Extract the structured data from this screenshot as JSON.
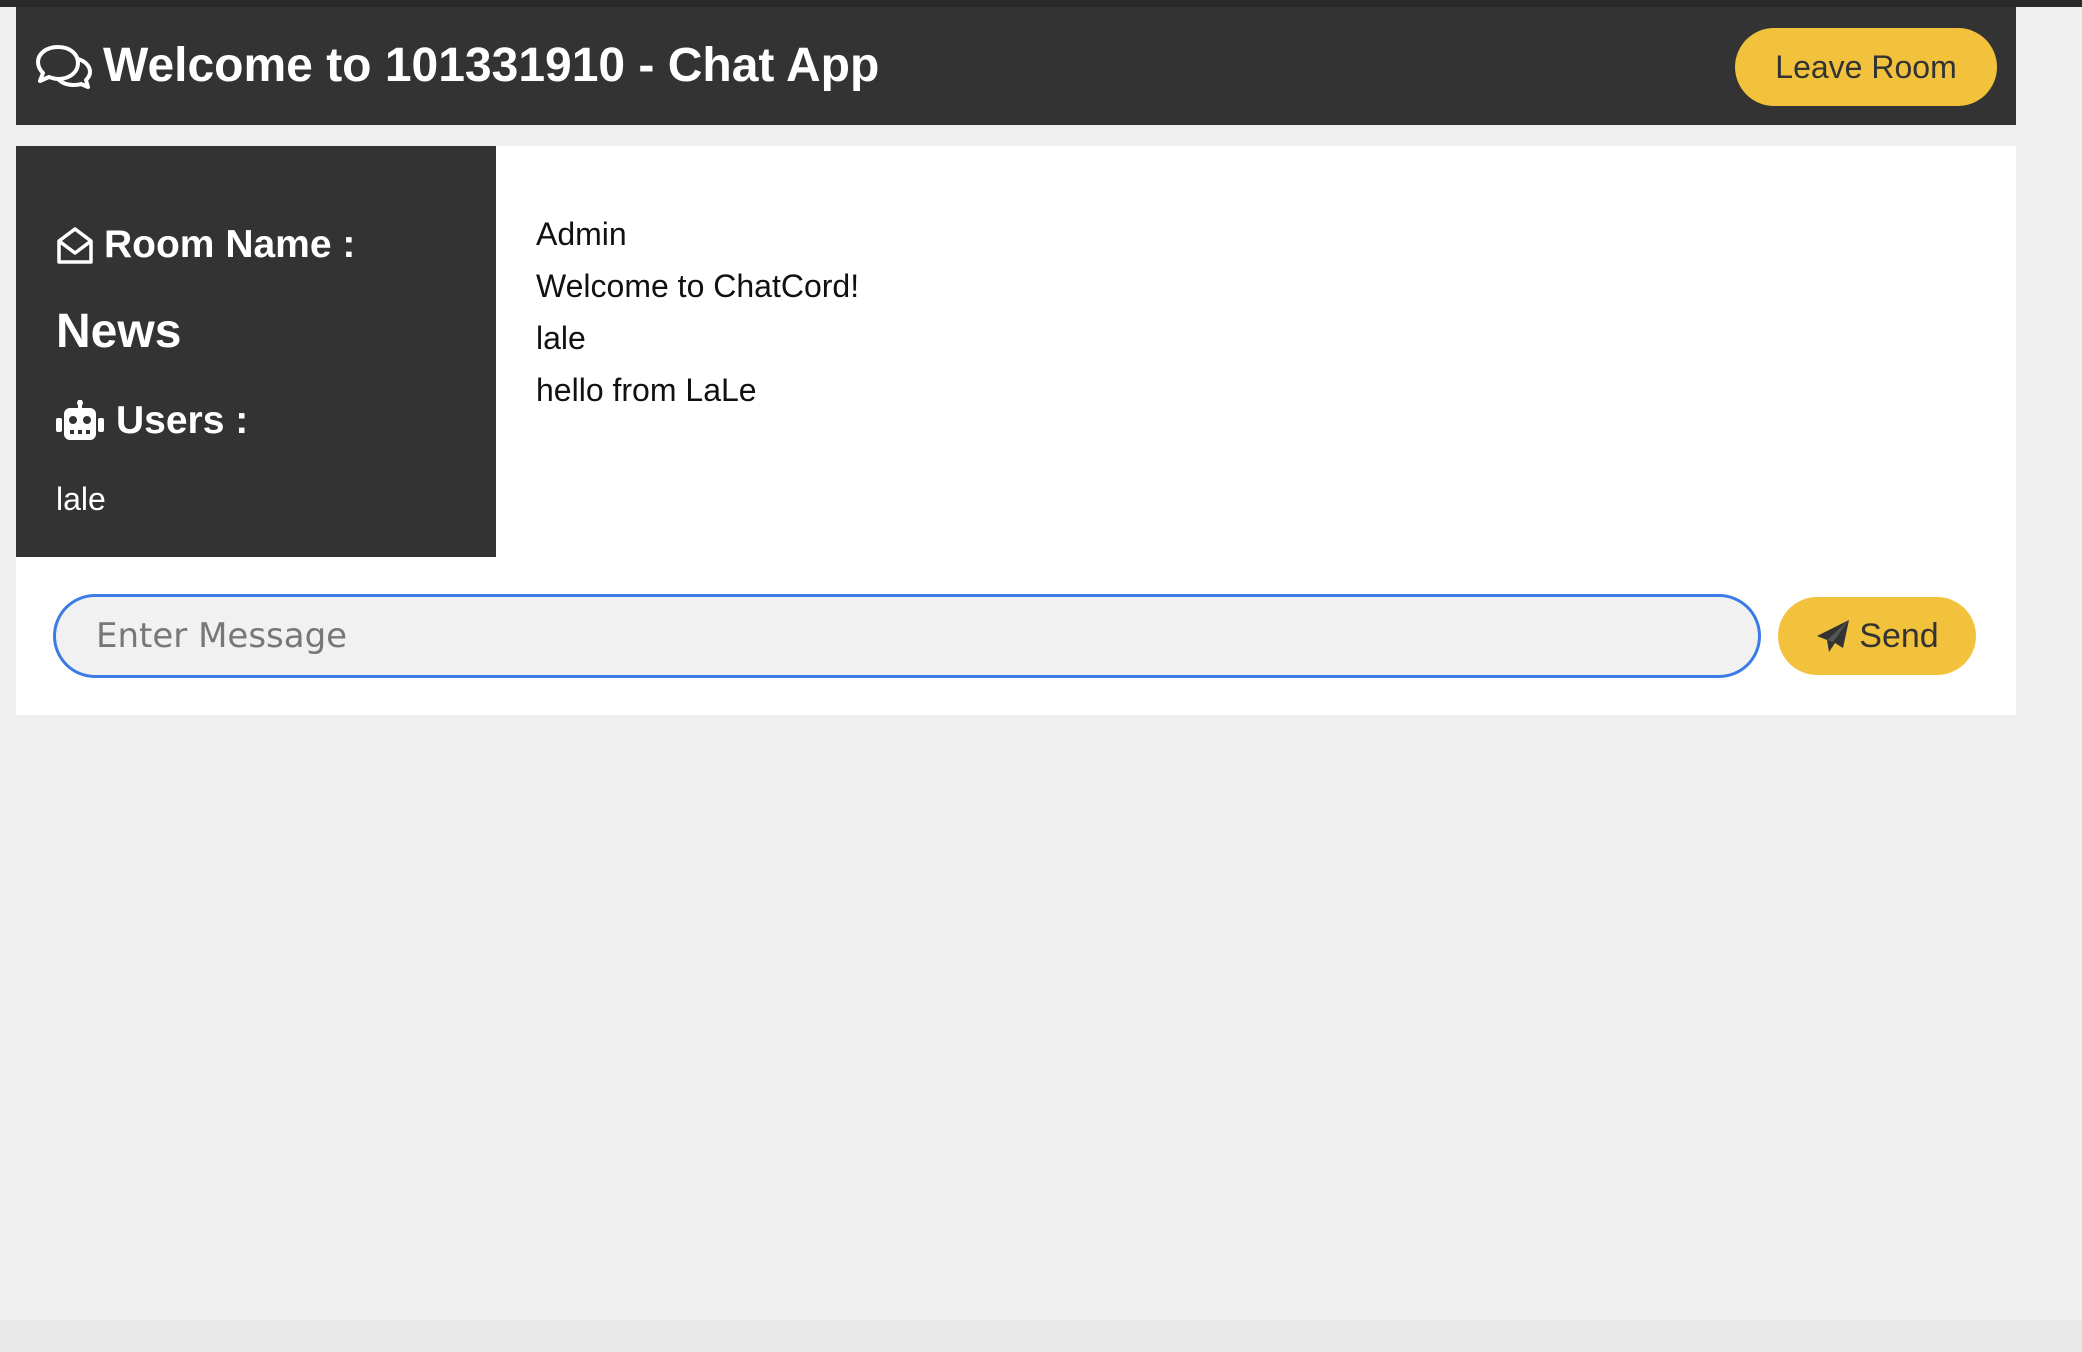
{
  "header": {
    "title": "Welcome to 101331910 - Chat App",
    "icon": "comments-icon",
    "leave_label": "Leave Room"
  },
  "sidebar": {
    "room_label": "Room Name :",
    "room_icon": "envelope-open-icon",
    "room_name": "News",
    "users_label": "Users :",
    "users_icon": "robot-icon",
    "users": [
      "lale"
    ]
  },
  "messages": [
    "Admin",
    "Welcome to ChatCord!",
    "lale",
    "hello from LaLe"
  ],
  "chat_form": {
    "input_placeholder": "Enter Message",
    "input_value": "",
    "send_label": "Send",
    "send_icon": "paper-plane-icon"
  },
  "colors": {
    "dark": "#333333",
    "accent": "#f2c23d",
    "focus_border": "#3b7be8",
    "background": "#f0f0f0"
  }
}
